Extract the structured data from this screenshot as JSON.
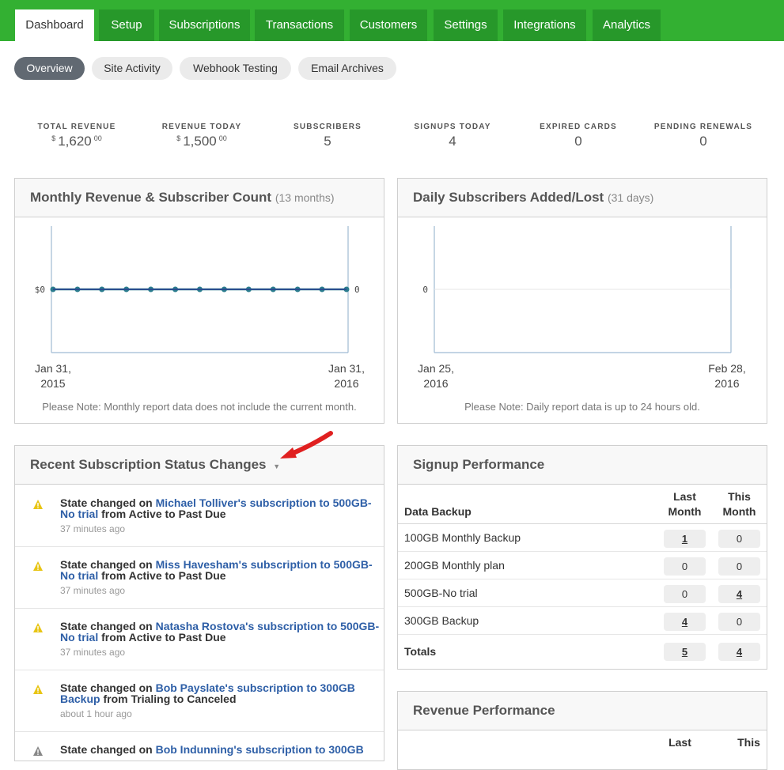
{
  "nav": {
    "tabs": [
      {
        "label": "Dashboard"
      },
      {
        "label": "Setup"
      },
      {
        "label": "Subscriptions"
      },
      {
        "label": "Transactions"
      },
      {
        "label": "Customers"
      },
      {
        "label": "Settings"
      },
      {
        "label": "Integrations"
      },
      {
        "label": "Analytics"
      }
    ]
  },
  "subnav": {
    "pills": [
      {
        "label": "Overview"
      },
      {
        "label": "Site Activity"
      },
      {
        "label": "Webhook Testing"
      },
      {
        "label": "Email Archives"
      }
    ]
  },
  "stats": [
    {
      "label": "TOTAL REVENUE",
      "currency": "$",
      "value": "1,620",
      "cents": "00"
    },
    {
      "label": "REVENUE TODAY",
      "currency": "$",
      "value": "1,500",
      "cents": "00"
    },
    {
      "label": "SUBSCRIBERS",
      "value": "5"
    },
    {
      "label": "SIGNUPS TODAY",
      "value": "4"
    },
    {
      "label": "EXPIRED CARDS",
      "value": "0"
    },
    {
      "label": "PENDING RENEWALS",
      "value": "0"
    }
  ],
  "monthly_panel": {
    "title": "Monthly Revenue & Subscriber Count",
    "subtitle": "(13 months)",
    "y_left_label": "$0",
    "y_right_label": "0",
    "start_date_line1": "Jan 31,",
    "start_date_line2": "2015",
    "end_date_line1": "Jan 31,",
    "end_date_line2": "2016",
    "note": "Please Note: Monthly report data does not include the current month."
  },
  "daily_panel": {
    "title": "Daily Subscribers Added/Lost",
    "subtitle": "(31 days)",
    "y_label": "0",
    "start_date_line1": "Jan 25,",
    "start_date_line2": "2016",
    "end_date_line1": "Feb 28,",
    "end_date_line2": "2016",
    "note": "Please Note: Daily report data is up to 24 hours old."
  },
  "chart_data": [
    {
      "type": "line",
      "title": "Monthly Revenue & Subscriber Count",
      "x_start": "Jan 31, 2015",
      "x_end": "Jan 31, 2016",
      "series": [
        {
          "values": [
            0,
            0,
            0,
            0,
            0,
            0,
            0,
            0,
            0,
            0,
            0,
            0,
            0
          ],
          "color": "#2b7c8e"
        },
        {
          "values": [
            0,
            0,
            0,
            0,
            0,
            0,
            0,
            0,
            0,
            0,
            0,
            0,
            0
          ],
          "color": "#2a3f8f"
        }
      ],
      "y_left_ticks": [
        "$0"
      ],
      "y_right_ticks": [
        "0"
      ]
    },
    {
      "type": "bar",
      "title": "Daily Subscribers Added/Lost",
      "x_start": "Jan 25, 2016",
      "x_end": "Feb 28, 2016",
      "values": [],
      "y_ticks": [
        "0"
      ]
    }
  ],
  "recent_panel": {
    "title": "Recent Subscription Status Changes",
    "items": [
      {
        "prefix": "State changed on",
        "link": "Michael Tolliver's subscription to 500GB-No trial",
        "suffix": "from Active to Past Due",
        "time": "37 minutes ago"
      },
      {
        "prefix": "State changed on",
        "link": "Miss Havesham's subscription to 500GB-No trial",
        "suffix": "from Active to Past Due",
        "time": "37 minutes ago"
      },
      {
        "prefix": "State changed on",
        "link": "Natasha Rostova's subscription to 500GB-No trial",
        "suffix": "from Active to Past Due",
        "time": "37 minutes ago"
      },
      {
        "prefix": "State changed on",
        "link": "Bob Payslate's subscription to 300GB Backup",
        "suffix": "from Trialing to Canceled",
        "time": "about 1 hour ago"
      },
      {
        "prefix": "State changed on",
        "link": "Bob Indunning's subscription to 300GB",
        "suffix": "",
        "time": ""
      }
    ]
  },
  "signup_panel": {
    "title": "Signup Performance",
    "group_label": "Data Backup",
    "col_last_line1": "Last",
    "col_last_line2": "Month",
    "col_this_line1": "This",
    "col_this_line2": "Month",
    "rows": [
      {
        "name": "100GB Monthly Backup",
        "last": "1",
        "this": "0"
      },
      {
        "name": "200GB Monthly plan",
        "last": "0",
        "this": "0"
      },
      {
        "name": "500GB-No trial",
        "last": "0",
        "this": "4"
      },
      {
        "name": "300GB Backup",
        "last": "4",
        "this": "0"
      }
    ],
    "totals_label": "Totals",
    "totals_last": "5",
    "totals_this": "4"
  },
  "revenue_panel": {
    "title": "Revenue Performance",
    "col_last_line1": "Last",
    "col_this_line1": "This"
  },
  "colors": {
    "nav_green": "#33b032",
    "tab_green": "#27982a",
    "link_blue": "#2e5fa7",
    "warning_yellow": "#e8c515",
    "annotation_red": "#e02020"
  }
}
